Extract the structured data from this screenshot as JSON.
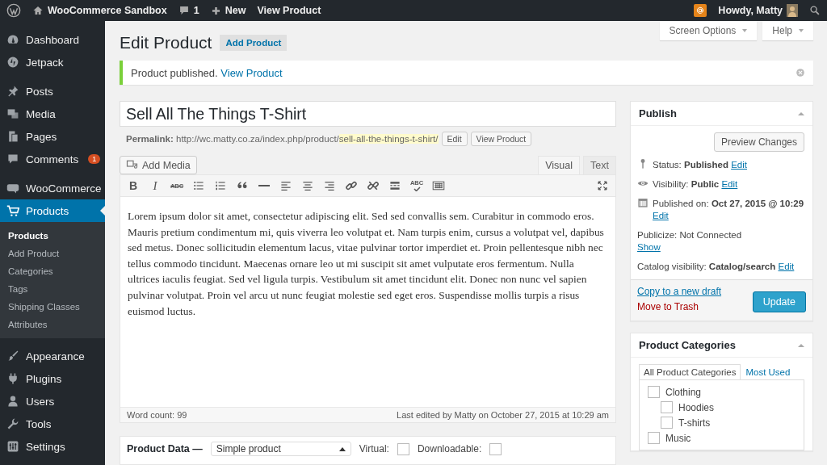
{
  "admin_bar": {
    "site": "WooCommerce Sandbox",
    "comments": "1",
    "new": "New",
    "view": "View Product",
    "greeting": "Howdy, Matty"
  },
  "sidebar": {
    "groups": [
      {
        "items": [
          {
            "label": "Dashboard",
            "selected": false
          },
          {
            "label": "Jetpack",
            "selected": false
          }
        ]
      },
      {
        "items": [
          {
            "label": "Posts",
            "selected": false
          },
          {
            "label": "Media",
            "selected": false
          },
          {
            "label": "Pages",
            "selected": false
          },
          {
            "label": "Comments",
            "selected": false,
            "badge": "1"
          }
        ]
      },
      {
        "items": [
          {
            "label": "WooCommerce",
            "selected": false
          },
          {
            "label": "Products",
            "selected": true,
            "children": [
              {
                "label": "Products",
                "selected": true
              },
              {
                "label": "Add Product",
                "selected": false
              },
              {
                "label": "Categories",
                "selected": false
              },
              {
                "label": "Tags",
                "selected": false
              },
              {
                "label": "Shipping Classes",
                "selected": false
              },
              {
                "label": "Attributes",
                "selected": false
              }
            ]
          }
        ]
      },
      {
        "items": [
          {
            "label": "Appearance",
            "selected": false
          },
          {
            "label": "Plugins",
            "selected": false
          },
          {
            "label": "Users",
            "selected": false
          },
          {
            "label": "Tools",
            "selected": false
          },
          {
            "label": "Settings",
            "selected": false
          }
        ]
      }
    ]
  },
  "screen_options": "Screen Options",
  "help": "Help",
  "page_title": "Edit Product",
  "add_button": "Add Product",
  "notice": {
    "text": "Product published.",
    "link": "View Product"
  },
  "title_field": {
    "value": "Sell All The Things T-Shirt"
  },
  "permalink": {
    "label": "Permalink:",
    "base": "http://wc.matty.co.za/index.php/product/",
    "slug": "sell-all-the-things-t-shirt/",
    "buttons": [
      "Edit",
      "View Product"
    ]
  },
  "add_media": "Add Media",
  "editor_tabs": [
    {
      "label": "Visual",
      "selected": true
    },
    {
      "label": "Text",
      "selected": false
    }
  ],
  "toolbar": [
    {
      "kind": "bold",
      "text": "B"
    },
    {
      "kind": "italic",
      "text": "I"
    },
    {
      "kind": "strike",
      "text": "ABC"
    },
    {
      "kind": "bullets"
    },
    {
      "kind": "numbers"
    },
    {
      "kind": "quote"
    },
    {
      "kind": "hr"
    },
    {
      "kind": "align-left"
    },
    {
      "kind": "align-center"
    },
    {
      "kind": "align-right"
    },
    {
      "kind": "link"
    },
    {
      "kind": "unlink"
    },
    {
      "kind": "more"
    },
    {
      "kind": "spellcheck",
      "text": "ABC"
    },
    {
      "kind": "keyboard"
    }
  ],
  "content": "Lorem ipsum dolor sit amet, consectetur adipiscing elit. Sed sed convallis sem. Curabitur in commodo eros. Mauris pretium condimentum mi, quis viverra leo volutpat et. Nam turpis enim, cursus a volutpat vel, dapibus sed metus. Donec sollicitudin elementum lacus, vitae pulvinar tortor imperdiet et. Proin pellentesque nibh nec tellus commodo tincidunt. Maecenas ornare leo ut mi suscipit sit amet vulputate eros fermentum. Nulla ultrices iaculis feugiat. Sed vel ligula turpis. Vestibulum sit amet tincidunt elit. Donec non nunc vel sapien pulvinar volutpat. Proin vel arcu ut nunc feugiat molestie sed eget eros. Suspendisse mollis turpis a risus euismod luctus.",
  "word_count": "Word count: 99",
  "last_edited": "Last edited by Matty on October 27, 2015 at 10:29 am",
  "product_data": {
    "label": "Product Data —",
    "type": "Simple product",
    "checkboxes": [
      {
        "label": "Virtual:",
        "checked": false
      },
      {
        "label": "Downloadable:",
        "checked": false
      }
    ]
  },
  "publish": {
    "title": "Publish",
    "preview": "Preview Changes",
    "rows": [
      {
        "kind": "inline",
        "text": "Status: **Published**",
        "link": "Edit"
      },
      {
        "kind": "inline",
        "text": "Visibility: **Public**",
        "link": "Edit"
      },
      {
        "kind": "stacked",
        "text": "Published on: **Oct 27, 2015 @ 10:29**",
        "link": "Edit"
      },
      {
        "kind": "stacked",
        "text": "Publicize: Not Connected",
        "link": "Show"
      },
      {
        "kind": "inline",
        "text": "Catalog visibility: **Catalog/search**",
        "link": "Edit"
      }
    ],
    "copy": "Copy to a new draft",
    "trash": "Move to Trash",
    "update": "Update"
  },
  "categories": {
    "title": "Product Categories",
    "tabs": [
      {
        "label": "All Product Categories",
        "selected": true
      },
      {
        "label": "Most Used",
        "selected": false
      }
    ],
    "items": [
      {
        "label": "Clothing",
        "checked": false,
        "children": [
          {
            "label": "Hoodies",
            "checked": false
          },
          {
            "label": "T-shirts",
            "checked": false
          }
        ]
      },
      {
        "label": "Music",
        "checked": false
      }
    ]
  }
}
